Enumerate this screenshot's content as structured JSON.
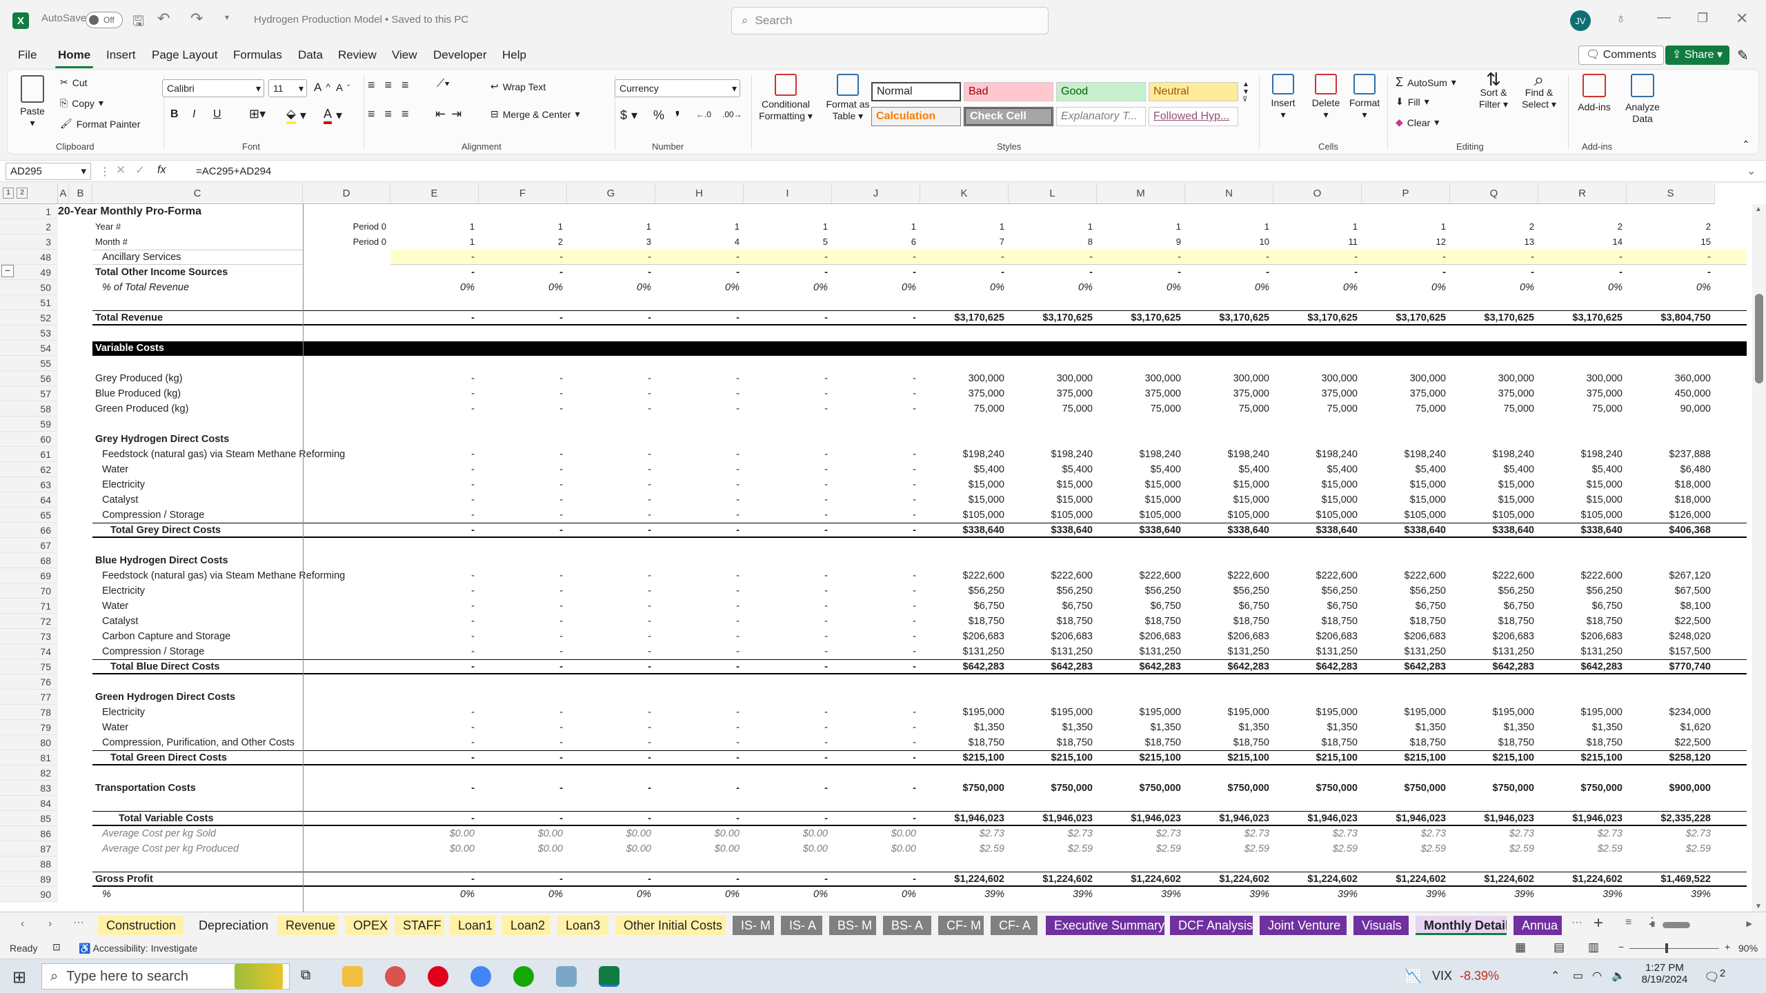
{
  "app": {
    "autosave_label": "AutoSave",
    "autosave_state": "Off",
    "title": "Hydrogen Production Model • Saved to this PC",
    "search_placeholder": "Search",
    "user_initials": "JV"
  },
  "menu": [
    "File",
    "Home",
    "Insert",
    "Page Layout",
    "Formulas",
    "Data",
    "Review",
    "View",
    "Developer",
    "Help"
  ],
  "menu_right": {
    "comments": "Comments",
    "share": "Share"
  },
  "ribbon": {
    "clipboard": {
      "paste": "Paste",
      "cut": "Cut",
      "copy": "Copy",
      "format_painter": "Format Painter",
      "label": "Clipboard"
    },
    "font": {
      "name": "Calibri",
      "size": "11",
      "label": "Font",
      "bold": "B",
      "italic": "I",
      "underline": "U"
    },
    "alignment": {
      "wrap": "Wrap Text",
      "merge": "Merge & Center",
      "label": "Alignment"
    },
    "number": {
      "format": "Currency",
      "dollar": "$",
      "percent": "%",
      "comma": "❜",
      "label": "Number"
    },
    "styles": {
      "conditional": "Conditional Formatting",
      "format_table": "Format as Table",
      "normal": "Normal",
      "bad": "Bad",
      "good": "Good",
      "neutral": "Neutral",
      "calculation": "Calculation",
      "check": "Check Cell",
      "explanatory": "Explanatory T...",
      "followed": "Followed Hyp...",
      "label": "Styles"
    },
    "cells": {
      "insert": "Insert",
      "delete": "Delete",
      "format": "Format",
      "label": "Cells"
    },
    "editing": {
      "autosum": "AutoSum",
      "fill": "Fill",
      "clear": "Clear",
      "sort": "Sort & Filter",
      "find": "Find & Select",
      "label": "Editing"
    },
    "addins": {
      "addins": "Add-ins",
      "analyze": "Analyze Data",
      "label": "Add-ins"
    }
  },
  "formula": {
    "namebox": "AD295",
    "fx": "fx",
    "formula": "=AC295+AD294"
  },
  "columns": [
    "A",
    "B",
    "C",
    "D",
    "E",
    "F",
    "G",
    "H",
    "I",
    "J",
    "K",
    "L",
    "M",
    "N",
    "O",
    "P",
    "Q",
    "R",
    "S"
  ],
  "rows": [
    {
      "n": "1",
      "label": "20-Year Monthly Pro-Forma",
      "style": "title",
      "vals": []
    },
    {
      "n": "2",
      "label": "Year #",
      "style": "small",
      "d": "Period 0",
      "vals": [
        "1",
        "1",
        "1",
        "1",
        "1",
        "1",
        "1",
        "1",
        "1",
        "1",
        "1",
        "1",
        "2",
        "2",
        "2"
      ]
    },
    {
      "n": "3",
      "label": "Month #",
      "style": "small",
      "d": "Period 0",
      "vals": [
        "1",
        "2",
        "3",
        "4",
        "5",
        "6",
        "7",
        "8",
        "9",
        "10",
        "11",
        "12",
        "13",
        "14",
        "15"
      ]
    },
    {
      "n": "48",
      "label": "Ancillary Services",
      "style": "input",
      "vals": [
        "-",
        "-",
        "-",
        "-",
        "-",
        "-",
        "-",
        "-",
        "-",
        "-",
        "-",
        "-",
        "-",
        "-",
        "-"
      ]
    },
    {
      "n": "49",
      "label": "Total Other Income Sources",
      "style": "bold",
      "vals": [
        "-",
        "-",
        "-",
        "-",
        "-",
        "-",
        "-",
        "-",
        "-",
        "-",
        "-",
        "-",
        "-",
        "-",
        "-"
      ]
    },
    {
      "n": "50",
      "label": "% of Total Revenue",
      "style": "italic",
      "vals": [
        "0%",
        "0%",
        "0%",
        "0%",
        "0%",
        "0%",
        "0%",
        "0%",
        "0%",
        "0%",
        "0%",
        "0%",
        "0%",
        "0%",
        "0%"
      ]
    },
    {
      "n": "51",
      "label": "",
      "vals": []
    },
    {
      "n": "52",
      "label": "Total Revenue",
      "style": "total",
      "vals": [
        "-",
        "-",
        "-",
        "-",
        "-",
        "-",
        "$3,170,625",
        "$3,170,625",
        "$3,170,625",
        "$3,170,625",
        "$3,170,625",
        "$3,170,625",
        "$3,170,625",
        "$3,170,625",
        "$3,804,750"
      ]
    },
    {
      "n": "53",
      "label": "",
      "vals": []
    },
    {
      "n": "54",
      "label": "Variable Costs",
      "style": "section",
      "vals": []
    },
    {
      "n": "55",
      "label": "",
      "vals": []
    },
    {
      "n": "56",
      "label": "Grey Produced (kg)",
      "vals": [
        "-",
        "-",
        "-",
        "-",
        "-",
        "-",
        "300,000",
        "300,000",
        "300,000",
        "300,000",
        "300,000",
        "300,000",
        "300,000",
        "300,000",
        "360,000"
      ]
    },
    {
      "n": "57",
      "label": "Blue Produced (kg)",
      "vals": [
        "-",
        "-",
        "-",
        "-",
        "-",
        "-",
        "375,000",
        "375,000",
        "375,000",
        "375,000",
        "375,000",
        "375,000",
        "375,000",
        "375,000",
        "450,000"
      ]
    },
    {
      "n": "58",
      "label": "Green Produced (kg)",
      "vals": [
        "-",
        "-",
        "-",
        "-",
        "-",
        "-",
        "75,000",
        "75,000",
        "75,000",
        "75,000",
        "75,000",
        "75,000",
        "75,000",
        "75,000",
        "90,000"
      ]
    },
    {
      "n": "59",
      "label": "",
      "vals": []
    },
    {
      "n": "60",
      "label": "Grey Hydrogen Direct Costs",
      "style": "bold",
      "vals": []
    },
    {
      "n": "61",
      "label": "Feedstock (natural gas) via Steam Methane Reforming",
      "style": "ind",
      "vals": [
        "-",
        "-",
        "-",
        "-",
        "-",
        "-",
        "$198,240",
        "$198,240",
        "$198,240",
        "$198,240",
        "$198,240",
        "$198,240",
        "$198,240",
        "$198,240",
        "$237,888"
      ]
    },
    {
      "n": "62",
      "label": "Water",
      "style": "ind",
      "vals": [
        "-",
        "-",
        "-",
        "-",
        "-",
        "-",
        "$5,400",
        "$5,400",
        "$5,400",
        "$5,400",
        "$5,400",
        "$5,400",
        "$5,400",
        "$5,400",
        "$6,480"
      ]
    },
    {
      "n": "63",
      "label": "Electricity",
      "style": "ind",
      "vals": [
        "-",
        "-",
        "-",
        "-",
        "-",
        "-",
        "$15,000",
        "$15,000",
        "$15,000",
        "$15,000",
        "$15,000",
        "$15,000",
        "$15,000",
        "$15,000",
        "$18,000"
      ]
    },
    {
      "n": "64",
      "label": "Catalyst",
      "style": "ind",
      "vals": [
        "-",
        "-",
        "-",
        "-",
        "-",
        "-",
        "$15,000",
        "$15,000",
        "$15,000",
        "$15,000",
        "$15,000",
        "$15,000",
        "$15,000",
        "$15,000",
        "$18,000"
      ]
    },
    {
      "n": "65",
      "label": "Compression / Storage",
      "style": "ind",
      "vals": [
        "-",
        "-",
        "-",
        "-",
        "-",
        "-",
        "$105,000",
        "$105,000",
        "$105,000",
        "$105,000",
        "$105,000",
        "$105,000",
        "$105,000",
        "$105,000",
        "$126,000"
      ]
    },
    {
      "n": "66",
      "label": "Total Grey Direct Costs",
      "style": "subtotal",
      "vals": [
        "-",
        "-",
        "-",
        "-",
        "-",
        "-",
        "$338,640",
        "$338,640",
        "$338,640",
        "$338,640",
        "$338,640",
        "$338,640",
        "$338,640",
        "$338,640",
        "$406,368"
      ]
    },
    {
      "n": "67",
      "label": "",
      "vals": []
    },
    {
      "n": "68",
      "label": "Blue Hydrogen Direct Costs",
      "style": "bold",
      "vals": []
    },
    {
      "n": "69",
      "label": "Feedstock (natural gas) via Steam Methane Reforming",
      "style": "ind",
      "vals": [
        "-",
        "-",
        "-",
        "-",
        "-",
        "-",
        "$222,600",
        "$222,600",
        "$222,600",
        "$222,600",
        "$222,600",
        "$222,600",
        "$222,600",
        "$222,600",
        "$267,120"
      ]
    },
    {
      "n": "70",
      "label": "Electricity",
      "style": "ind",
      "vals": [
        "-",
        "-",
        "-",
        "-",
        "-",
        "-",
        "$56,250",
        "$56,250",
        "$56,250",
        "$56,250",
        "$56,250",
        "$56,250",
        "$56,250",
        "$56,250",
        "$67,500"
      ]
    },
    {
      "n": "71",
      "label": "Water",
      "style": "ind",
      "vals": [
        "-",
        "-",
        "-",
        "-",
        "-",
        "-",
        "$6,750",
        "$6,750",
        "$6,750",
        "$6,750",
        "$6,750",
        "$6,750",
        "$6,750",
        "$6,750",
        "$8,100"
      ]
    },
    {
      "n": "72",
      "label": "Catalyst",
      "style": "ind",
      "vals": [
        "-",
        "-",
        "-",
        "-",
        "-",
        "-",
        "$18,750",
        "$18,750",
        "$18,750",
        "$18,750",
        "$18,750",
        "$18,750",
        "$18,750",
        "$18,750",
        "$22,500"
      ]
    },
    {
      "n": "73",
      "label": "Carbon Capture and Storage",
      "style": "ind",
      "vals": [
        "-",
        "-",
        "-",
        "-",
        "-",
        "-",
        "$206,683",
        "$206,683",
        "$206,683",
        "$206,683",
        "$206,683",
        "$206,683",
        "$206,683",
        "$206,683",
        "$248,020"
      ]
    },
    {
      "n": "74",
      "label": "Compression / Storage",
      "style": "ind",
      "vals": [
        "-",
        "-",
        "-",
        "-",
        "-",
        "-",
        "$131,250",
        "$131,250",
        "$131,250",
        "$131,250",
        "$131,250",
        "$131,250",
        "$131,250",
        "$131,250",
        "$157,500"
      ]
    },
    {
      "n": "75",
      "label": "Total Blue Direct Costs",
      "style": "subtotal",
      "vals": [
        "-",
        "-",
        "-",
        "-",
        "-",
        "-",
        "$642,283",
        "$642,283",
        "$642,283",
        "$642,283",
        "$642,283",
        "$642,283",
        "$642,283",
        "$642,283",
        "$770,740"
      ]
    },
    {
      "n": "76",
      "label": "",
      "vals": []
    },
    {
      "n": "77",
      "label": "Green Hydrogen Direct Costs",
      "style": "bold",
      "vals": []
    },
    {
      "n": "78",
      "label": "Electricity",
      "style": "ind",
      "vals": [
        "-",
        "-",
        "-",
        "-",
        "-",
        "-",
        "$195,000",
        "$195,000",
        "$195,000",
        "$195,000",
        "$195,000",
        "$195,000",
        "$195,000",
        "$195,000",
        "$234,000"
      ]
    },
    {
      "n": "79",
      "label": "Water",
      "style": "ind",
      "vals": [
        "-",
        "-",
        "-",
        "-",
        "-",
        "-",
        "$1,350",
        "$1,350",
        "$1,350",
        "$1,350",
        "$1,350",
        "$1,350",
        "$1,350",
        "$1,350",
        "$1,620"
      ]
    },
    {
      "n": "80",
      "label": "Compression, Purification, and Other Costs",
      "style": "ind",
      "vals": [
        "-",
        "-",
        "-",
        "-",
        "-",
        "-",
        "$18,750",
        "$18,750",
        "$18,750",
        "$18,750",
        "$18,750",
        "$18,750",
        "$18,750",
        "$18,750",
        "$22,500"
      ]
    },
    {
      "n": "81",
      "label": "Total Green Direct Costs",
      "style": "subtotal",
      "vals": [
        "-",
        "-",
        "-",
        "-",
        "-",
        "-",
        "$215,100",
        "$215,100",
        "$215,100",
        "$215,100",
        "$215,100",
        "$215,100",
        "$215,100",
        "$215,100",
        "$258,120"
      ]
    },
    {
      "n": "82",
      "label": "",
      "vals": []
    },
    {
      "n": "83",
      "label": "Transportation Costs",
      "style": "bold",
      "vals": [
        "-",
        "-",
        "-",
        "-",
        "-",
        "-",
        "$750,000",
        "$750,000",
        "$750,000",
        "$750,000",
        "$750,000",
        "$750,000",
        "$750,000",
        "$750,000",
        "$900,000"
      ]
    },
    {
      "n": "84",
      "label": "",
      "vals": []
    },
    {
      "n": "85",
      "label": "Total Variable Costs",
      "style": "subtotal2",
      "vals": [
        "-",
        "-",
        "-",
        "-",
        "-",
        "-",
        "$1,946,023",
        "$1,946,023",
        "$1,946,023",
        "$1,946,023",
        "$1,946,023",
        "$1,946,023",
        "$1,946,023",
        "$1,946,023",
        "$2,335,228"
      ]
    },
    {
      "n": "86",
      "label": "Average Cost per kg Sold",
      "style": "grey",
      "vals": [
        "$0.00",
        "$0.00",
        "$0.00",
        "$0.00",
        "$0.00",
        "$0.00",
        "$2.73",
        "$2.73",
        "$2.73",
        "$2.73",
        "$2.73",
        "$2.73",
        "$2.73",
        "$2.73",
        "$2.73"
      ]
    },
    {
      "n": "87",
      "label": "Average Cost per kg Produced",
      "style": "grey",
      "vals": [
        "$0.00",
        "$0.00",
        "$0.00",
        "$0.00",
        "$0.00",
        "$0.00",
        "$2.59",
        "$2.59",
        "$2.59",
        "$2.59",
        "$2.59",
        "$2.59",
        "$2.59",
        "$2.59",
        "$2.59"
      ]
    },
    {
      "n": "88",
      "label": "",
      "vals": []
    },
    {
      "n": "89",
      "label": "Gross Profit",
      "style": "total",
      "vals": [
        "-",
        "-",
        "-",
        "-",
        "-",
        "-",
        "$1,224,602",
        "$1,224,602",
        "$1,224,602",
        "$1,224,602",
        "$1,224,602",
        "$1,224,602",
        "$1,224,602",
        "$1,224,602",
        "$1,469,522"
      ]
    },
    {
      "n": "90",
      "label": "%",
      "style": "italic",
      "vals": [
        "0%",
        "0%",
        "0%",
        "0%",
        "0%",
        "0%",
        "39%",
        "39%",
        "39%",
        "39%",
        "39%",
        "39%",
        "39%",
        "39%",
        "39%"
      ]
    }
  ],
  "tabs": [
    {
      "label": "Construction",
      "color": "#fff2a8",
      "text": "#222"
    },
    {
      "label": "Depreciation",
      "color": "#f3f3f3",
      "text": "#222"
    },
    {
      "label": "Revenue",
      "color": "#fff2a8",
      "text": "#222"
    },
    {
      "label": "OPEX",
      "color": "#fff2a8",
      "text": "#222"
    },
    {
      "label": "STAFF",
      "color": "#fff2a8",
      "text": "#222"
    },
    {
      "label": "Loan1",
      "color": "#fff2a8",
      "text": "#222"
    },
    {
      "label": "Loan2",
      "color": "#fff2a8",
      "text": "#222"
    },
    {
      "label": "Loan3",
      "color": "#fff2a8",
      "text": "#222"
    },
    {
      "label": "Other Initial Costs",
      "color": "#fff2a8",
      "text": "#222"
    },
    {
      "label": "IS- M",
      "color": "#808080",
      "text": "#fff"
    },
    {
      "label": "IS- A",
      "color": "#808080",
      "text": "#fff"
    },
    {
      "label": "BS- M",
      "color": "#808080",
      "text": "#fff"
    },
    {
      "label": "BS- A",
      "color": "#808080",
      "text": "#fff"
    },
    {
      "label": "CF- M",
      "color": "#808080",
      "text": "#fff"
    },
    {
      "label": "CF- A",
      "color": "#808080",
      "text": "#fff"
    },
    {
      "label": "Executive Summary",
      "color": "#7030a0",
      "text": "#fff"
    },
    {
      "label": "DCF Analysis",
      "color": "#7030a0",
      "text": "#fff"
    },
    {
      "label": "Joint Venture",
      "color": "#7030a0",
      "text": "#fff"
    },
    {
      "label": "Visuals",
      "color": "#7030a0",
      "text": "#fff"
    },
    {
      "label": "Monthly Detail",
      "color": "#e6d5f2",
      "text": "#222",
      "active": true
    },
    {
      "label": "Annua",
      "color": "#7030a0",
      "text": "#fff"
    }
  ],
  "status": {
    "ready": "Ready",
    "accessibility": "Accessibility: Investigate",
    "zoom": "90%"
  },
  "taskbar": {
    "search": "Type here to search",
    "ticker": "VIX",
    "change": "-8.39%",
    "time": "1:27 PM",
    "date": "8/19/2024",
    "notif": "2"
  }
}
